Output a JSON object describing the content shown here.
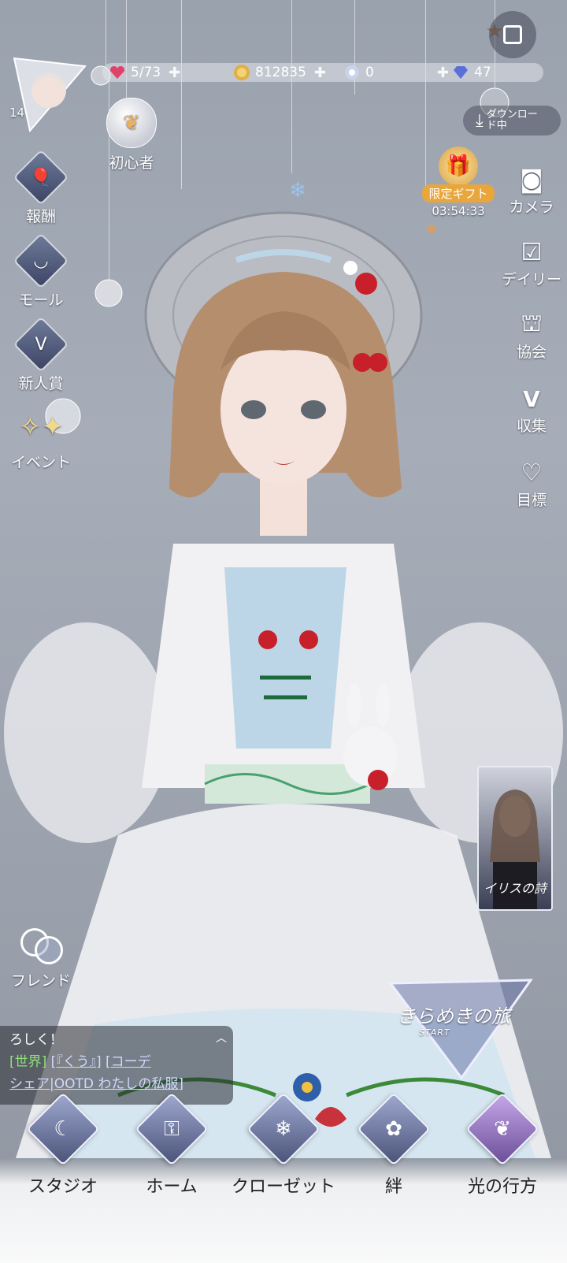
{
  "top_bar": {
    "level": "14",
    "stamina": "5/73",
    "gold": "812835",
    "crystal": "0",
    "diamond": "47"
  },
  "top_right": {
    "download_label": "ダウンロード中",
    "gift_label": "限定ギフト",
    "gift_timer": "03:54:33"
  },
  "left_menu": {
    "beginner": "初心者",
    "reward": "報酬",
    "mall": "モール",
    "newcomer": "新人賞",
    "event": "イベント",
    "friend": "フレンド"
  },
  "right_menu": {
    "camera": "カメラ",
    "daily": "デイリー",
    "guild": "協会",
    "collection": "収集",
    "goal": "目標"
  },
  "banner": {
    "title": "イリスの詩"
  },
  "journey": {
    "title": "きらめきの旅",
    "start": "START"
  },
  "chat": {
    "line1": "ろしく！",
    "channel": "[世界]",
    "link1": "[『くう』]",
    "link2": "[コーデ",
    "line3": "シェア|OOTD わたしの私服]"
  },
  "bottom_nav": {
    "studio": "スタジオ",
    "home": "ホーム",
    "closet": "クローゼット",
    "bond": "絆",
    "light": "光の行方"
  },
  "colors": {
    "background": "#9aa2ae",
    "dress_blue": "#bcd6e8",
    "hair": "#b58e6e",
    "accent_red": "#c8202a"
  }
}
